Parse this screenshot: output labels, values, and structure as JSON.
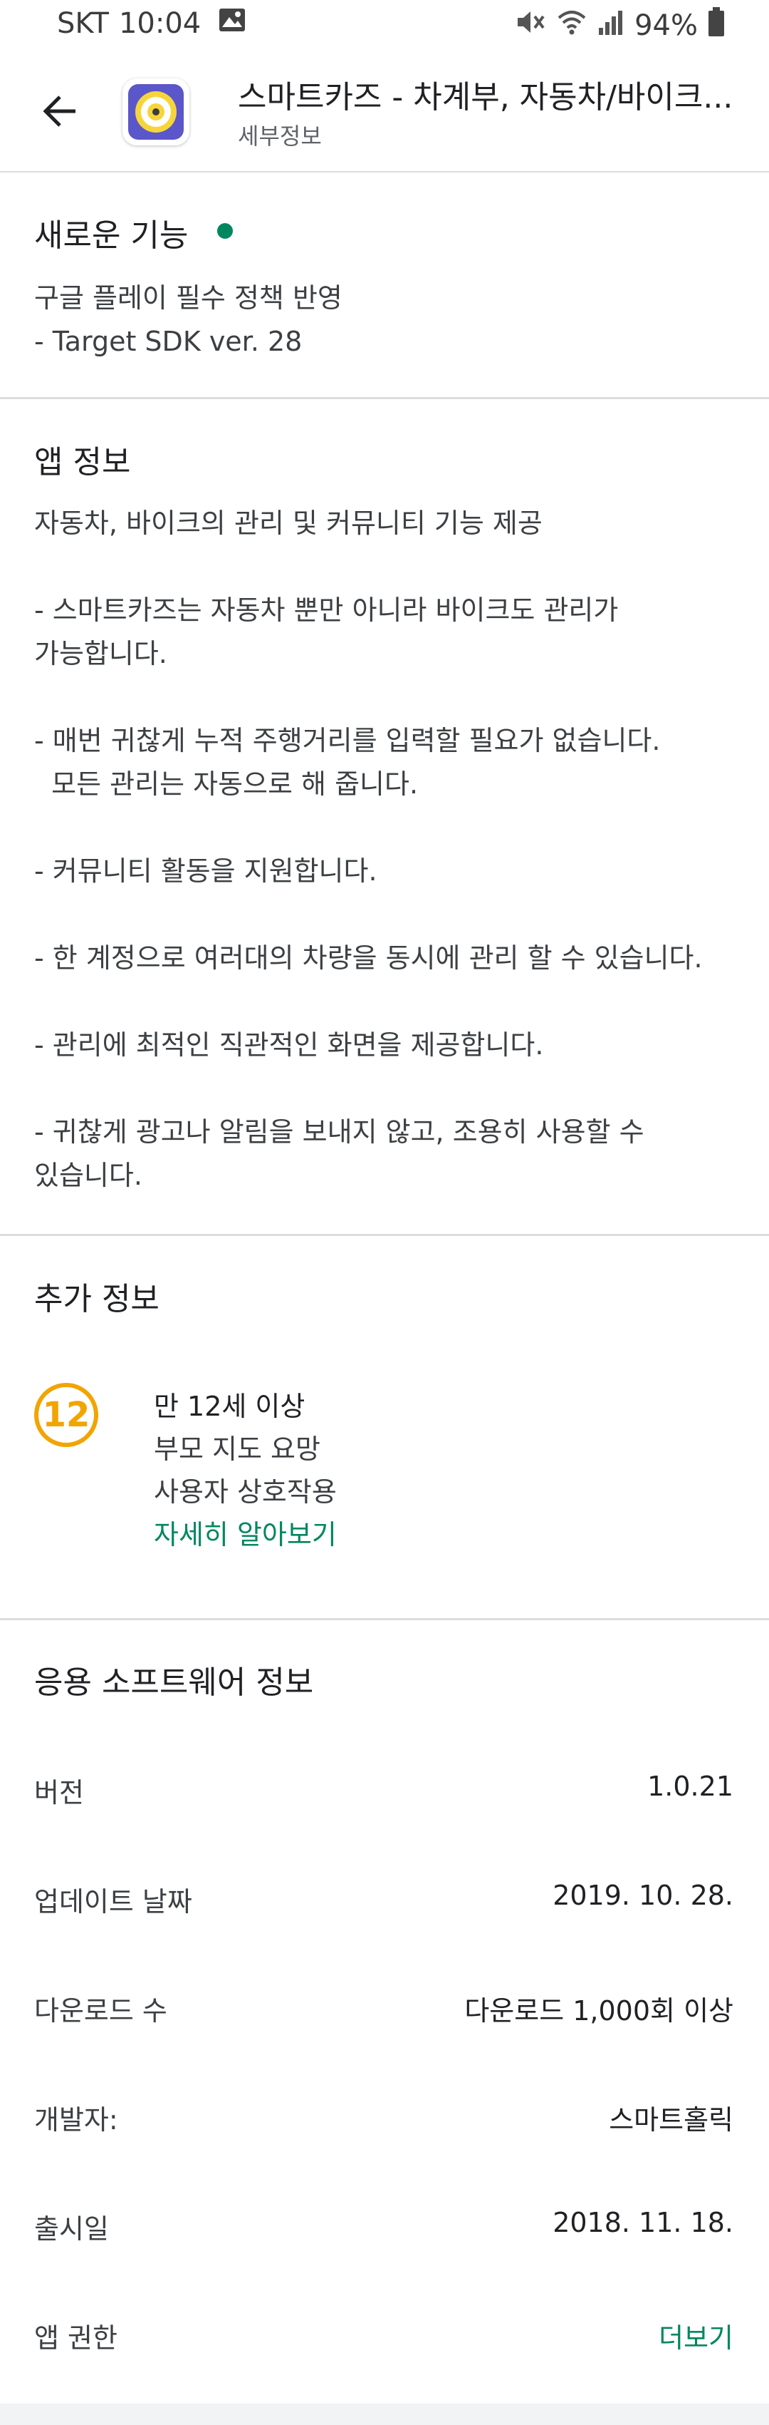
{
  "status_bar": {
    "carrier": "SKT",
    "time": "10:04",
    "battery": "94%"
  },
  "header": {
    "app_title": "스마트카즈 - 차계부, 자동차/바이크...",
    "subtitle": "세부정보"
  },
  "whats_new": {
    "title": "새로운 기능",
    "lines": [
      "구글 플레이 필수 정책 반영",
      "- Target SDK ver. 28"
    ]
  },
  "app_info": {
    "title": "앱 정보",
    "lines": [
      "자동차, 바이크의 관리 및 커뮤니티 기능 제공",
      "- 스마트카즈는 자동차 뿐만 아니라 바이크도 관리가",
      "가능합니다.",
      "- 매번 귀찮게 누적 주행거리를 입력할 필요가 없습니다.",
      "  모든 관리는 자동으로 해 줍니다.",
      "- 커뮤니티 활동을 지원합니다.",
      "- 한 계정으로 여러대의 차량을 동시에 관리 할 수 있습니다.",
      "- 관리에 최적인 직관적인 화면을 제공합니다.",
      "- 귀찮게 광고나 알림을 보내지 않고, 조용히 사용할 수",
      "있습니다."
    ]
  },
  "additional_info": {
    "title": "추가 정보",
    "age_badge": "12",
    "rating": "만 12세 이상",
    "guidance": "부모 지도 요망",
    "interaction": "사용자 상호작용",
    "learn_more": "자세히 알아보기"
  },
  "software_info": {
    "title": "응용 소프트웨어 정보",
    "rows": [
      {
        "label": "버전",
        "value": "1.0.21"
      },
      {
        "label": "업데이트 날짜",
        "value": "2019. 10. 28."
      },
      {
        "label": "다운로드 수",
        "value": "다운로드 1,000회 이상"
      },
      {
        "label": "개발자:",
        "value": "스마트홀릭"
      },
      {
        "label": "출시일",
        "value": "2018. 11. 18."
      },
      {
        "label": "앱 권한",
        "value": "더보기"
      }
    ]
  },
  "colors": {
    "accent_green": "#01875f",
    "badge_orange": "#f2a400",
    "divider": "#dadce0"
  }
}
